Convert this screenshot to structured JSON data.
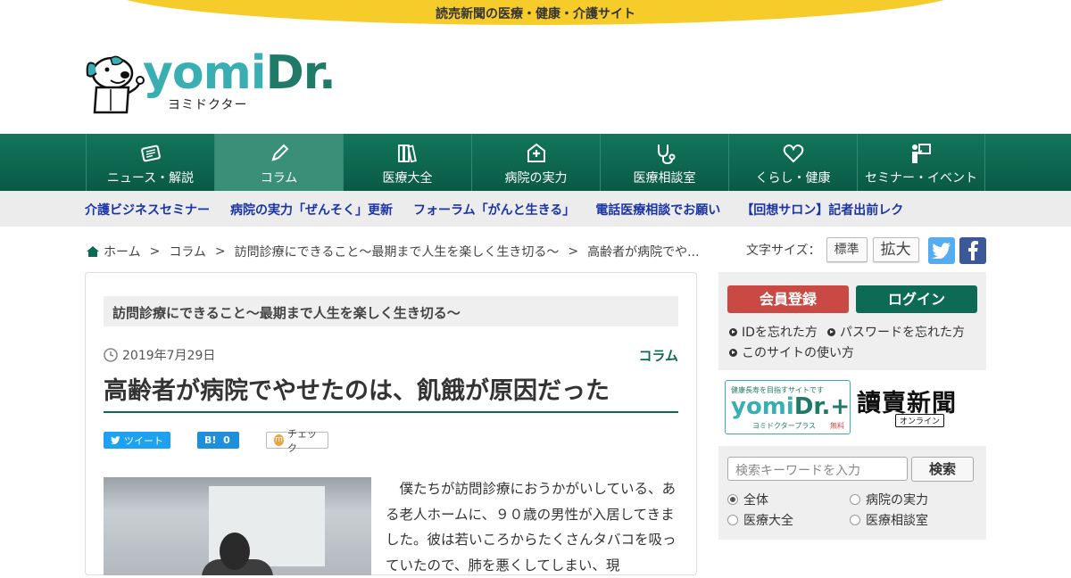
{
  "topbar": {
    "tagline": "読売新聞の医療・健康・介護サイト"
  },
  "logo": {
    "wordmark_yomi": "yomi",
    "wordmark_dr": "Dr.",
    "kana": "ヨミドクター"
  },
  "nav": {
    "items": [
      {
        "label": "ニュース・解説",
        "icon": "newspaper-icon"
      },
      {
        "label": "コラム",
        "icon": "pen-icon",
        "active": true
      },
      {
        "label": "医療大全",
        "icon": "books-icon"
      },
      {
        "label": "病院の実力",
        "icon": "hospital-icon"
      },
      {
        "label": "医療相談室",
        "icon": "stethoscope-icon"
      },
      {
        "label": "くらし・健康",
        "icon": "heart-icon"
      },
      {
        "label": "セミナー・イベント",
        "icon": "presenter-icon"
      }
    ]
  },
  "subnav": {
    "items": [
      "介護ビジネスセミナー",
      "病院の実力「ぜんそく」更新",
      "フォーラム「がんと生きる」",
      "電話医療相談でお願い",
      "【回想サロン】記者出前レク"
    ]
  },
  "breadcrumb": {
    "home": "ホーム",
    "sep": ">",
    "items": [
      "コラム",
      "訪問診療にできること～最期まで人生を楽しく生き切る～",
      "高齢者が病院でや..."
    ]
  },
  "font_size": {
    "label": "文字サイズ：",
    "standard": "標準",
    "large": "拡大"
  },
  "social": {
    "twitter": "twitter-icon",
    "facebook": "facebook-icon"
  },
  "article": {
    "series": "訪問診療にできること～最期まで人生を楽しく生き切る～",
    "date": "2019年7月29日",
    "category": "コラム",
    "title": "高齢者が病院でやせたのは、飢餓が原因だった",
    "share": {
      "tweet": "ツイート",
      "hatena": "B!",
      "hatena_count": "0",
      "mixi_mark": "m",
      "mixi": "チェック"
    },
    "body": "　僕たちが訪問診療におうかがいしている、ある老人ホームに、９０歳の男性が入居してきました。彼は若いころからたくさんタバコを吸っていたので、肺を悪くしてしまい、現"
  },
  "sidebar": {
    "register": "会員登録",
    "login": "ログイン",
    "links": [
      "IDを忘れた方",
      "パスワードを忘れた方",
      "このサイトの使い方"
    ],
    "plus_banner": {
      "tagline": "健康長寿を目指すサイトです",
      "word_yomi": "yomi",
      "word_dr": "Dr.+",
      "kana": "ヨミドクタープラス",
      "free": "無料"
    },
    "yomiuri_banner": {
      "name": "讀賣新聞",
      "online": "オンライン"
    },
    "search": {
      "placeholder": "検索キーワードを入力",
      "button": "検索",
      "options": [
        "全体",
        "病院の実力",
        "医療大全",
        "医療相談室"
      ],
      "selected": "全体"
    }
  }
}
